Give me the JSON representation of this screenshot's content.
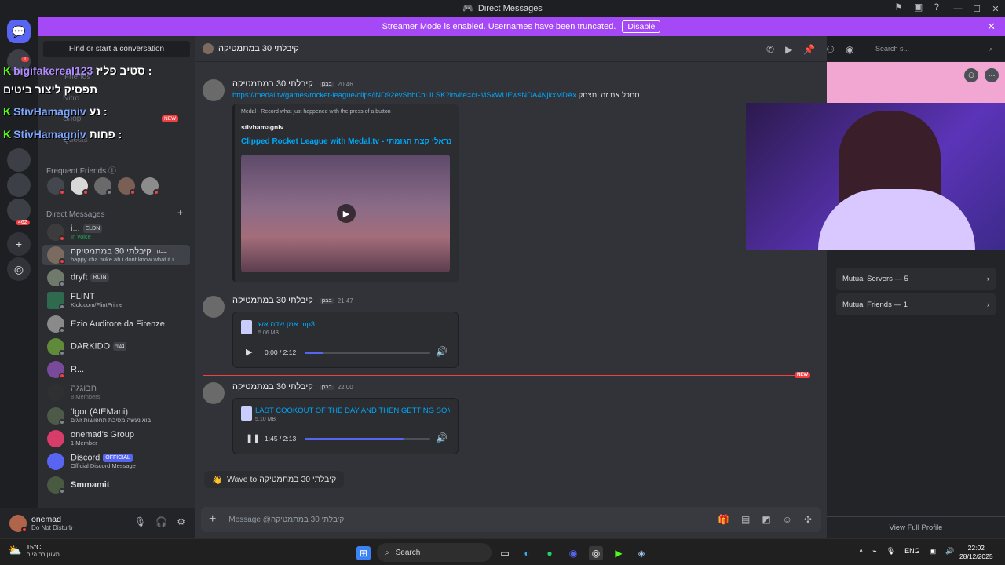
{
  "window": {
    "title": "Direct Messages"
  },
  "banner": {
    "text": "Streamer Mode is enabled. Usernames have been truncated.",
    "button": "Disable"
  },
  "sidebar": {
    "search_button": "Find or start a conversation",
    "nav_items": [
      "Friends",
      "Nitro",
      "Shop",
      "Quests"
    ],
    "shop_badge": "NEW",
    "frequent_friends_label": "Frequent Friends",
    "direct_messages_label": "Direct Messages",
    "dms": [
      {
        "name": "i...",
        "badge": "ELDN",
        "sub": "In voice"
      },
      {
        "name": "קיבלתי 30 במתמטיקה",
        "badge": "בבנן",
        "sub": "happy cha nuke ah i dont know what it i..."
      },
      {
        "name": "dryft",
        "badge": "RUIN",
        "sub": ""
      },
      {
        "name": "FLINT",
        "badge": "",
        "sub": "Kick.com/FlintPrime"
      },
      {
        "name": "Ezio Auditore da Firenze",
        "badge": "",
        "sub": ""
      },
      {
        "name": "DARKIDO",
        "badge": "נשוי",
        "sub": ""
      },
      {
        "name": "R...",
        "badge": "",
        "sub": ""
      },
      {
        "name": "חבוגגה",
        "badge": "",
        "sub": "8 Members"
      },
      {
        "name": "'Igor (AtEMani)",
        "badge": "",
        "sub": "בוא נעשה מסיבת תחפושות זוגים"
      },
      {
        "name": "onemad's Group",
        "badge": "",
        "sub": "1 Member"
      },
      {
        "name": "Discord",
        "badge": "OFFICIAL",
        "sub": "Official Discord Message"
      },
      {
        "name": "Smmamit",
        "badge": "",
        "sub": ""
      }
    ]
  },
  "server_rail": {
    "badges": [
      "1",
      "462"
    ]
  },
  "overlay_chat": [
    {
      "user": "bigifakereal123",
      "message": "סטיב פליז :"
    },
    {
      "user": "",
      "message": "תפסיק ליצור ביטים"
    },
    {
      "user": "StivHamagniv",
      "message": "נע :"
    },
    {
      "user": "StivHamagniv",
      "message": "פחות :"
    }
  ],
  "user_panel": {
    "name": "onemad",
    "status": "Do Not Disturb"
  },
  "chat": {
    "header_name": "קיבלתי 30 במתמטיקה",
    "search_placeholder": "Search s...",
    "messages": [
      {
        "author": "קיבלתי 30 במתמטיקה",
        "tag": "בבנן",
        "time": "20:46",
        "link": "https://medal.tv/games/rocket-league/clips/lND92evShbChLILSK?invite=cr-MSxWUEwsNDA4NjkxMDAx",
        "text": "סתכל את זה ותצחק",
        "embed": {
          "provider": "Medal - Record what just happened with the press of a button",
          "author": "stivhamagniv",
          "title": "Clipped Rocket League with Medal.tv - נראלי קצת הגזמתי"
        }
      },
      {
        "author": "קיבלתי 30 במתמטיקה",
        "tag": "בבנן",
        "time": "21:47",
        "file": {
          "name": "אמן שדה אש.mp3",
          "size": "5.06 MB",
          "time": "0:00 / 2:12",
          "progress": 0.15
        }
      },
      {
        "author": "קיבלתי 30 במתמטיקה",
        "tag": "בבנן",
        "time": "22:00",
        "file": {
          "name": "LAST COOKOUT OF THE DAY AND THEN GETTING SOM",
          "size": "5.10 MB",
          "time": "1:45 / 2:13",
          "progress": 0.79
        }
      }
    ],
    "new_label": "NEW",
    "wave": "Wave to קיבלתי 30 במתמטיקה",
    "composer_placeholder": "Message @קיבלתי 30 במתמטיקה"
  },
  "profile": {
    "game_collection": "Game Collection",
    "mutual_servers": "Mutual Servers — 5",
    "mutual_friends": "Mutual Friends — 1",
    "view_full": "View Full Profile"
  },
  "taskbar": {
    "weather_temp": "15°C",
    "weather_desc": "מעונן רב היום",
    "search": "Search",
    "lang": "ENG",
    "time": "22:02",
    "date": "28/12/2025"
  },
  "colors": {
    "accent": "#5865f2",
    "banner": "#a548f5",
    "danger": "#f23f43",
    "link": "#00a8fc"
  }
}
